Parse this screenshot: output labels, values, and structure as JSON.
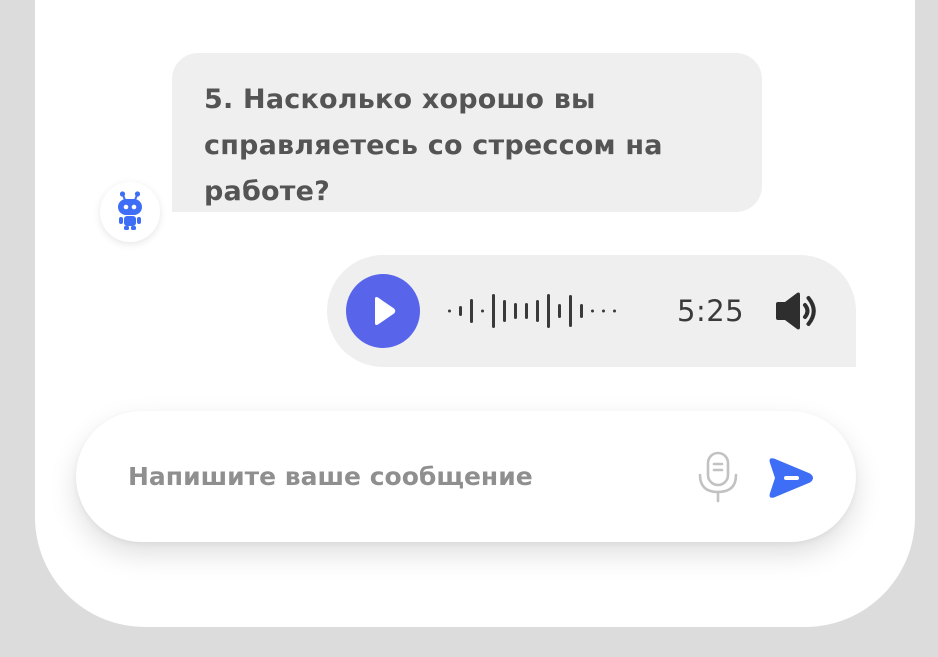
{
  "chat": {
    "bot_message": "5. Насколько хорошо вы справляетесь со стрессом на работе?",
    "bot_avatar_icon": "robot-icon",
    "voice_message": {
      "duration": "5:25",
      "play_icon": "play-icon",
      "volume_icon": "speaker-icon"
    }
  },
  "composer": {
    "placeholder": "Напишите ваше сообщение",
    "value": "",
    "mic_icon": "microphone-icon",
    "send_icon": "send-icon"
  },
  "colors": {
    "accent": "#5865ea",
    "bot_icon": "#3d6ef5",
    "send": "#3d6ef5",
    "bubble_bg": "#efeff0",
    "page_bg": "#dcdcdc"
  }
}
